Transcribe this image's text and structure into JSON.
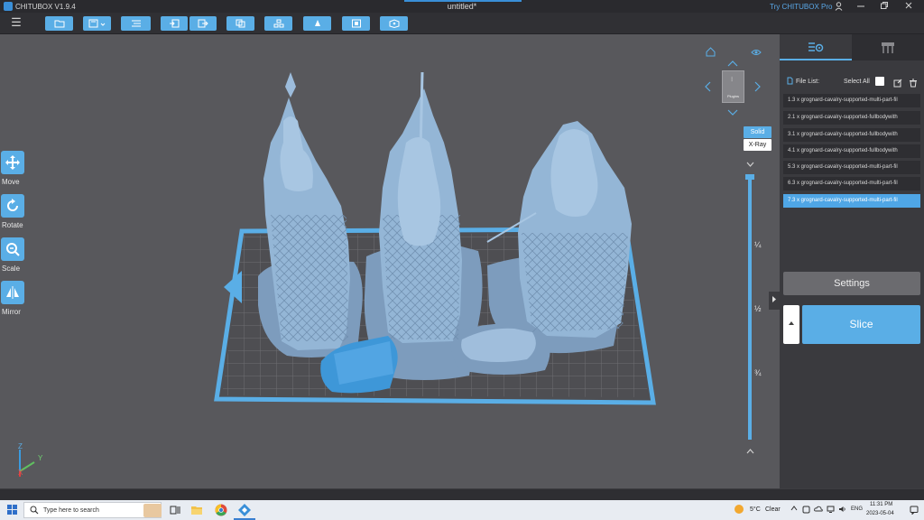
{
  "app": {
    "name": "CHITUBOX V1.9.4",
    "document_title": "untitled*",
    "pro_link": "Try CHITUBOX Pro"
  },
  "window_controls": [
    "minimize",
    "restore",
    "close"
  ],
  "toolbar": {
    "menu_icon": "hamburger-icon",
    "buttons": [
      "open-file-icon",
      "save-dropdown-icon",
      "slice-settings-icon",
      "import-icon",
      "export-icon",
      "copy-icon",
      "layout-icon",
      "support-icon",
      "hollow-icon",
      "dig-hole-icon"
    ]
  },
  "left_tools": [
    {
      "label": "Move",
      "icon": "move-icon"
    },
    {
      "label": "Rotate",
      "icon": "rotate-icon"
    },
    {
      "label": "Scale",
      "icon": "scale-icon"
    },
    {
      "label": "Mirror",
      "icon": "mirror-icon"
    }
  ],
  "view": {
    "navcube_face": "Plugins",
    "modes": [
      "Solid",
      "X-Ray"
    ],
    "active_mode": "Solid",
    "layer_marks": [
      "¼",
      "½",
      "¾"
    ],
    "axes": [
      "Z",
      "Y",
      "X"
    ]
  },
  "colors": {
    "accent": "#5aaee6",
    "model": "#8fb4d4",
    "selected_model": "#3e97d8",
    "viewport_bg": "#58585c",
    "panel_bg": "#3a3a3e"
  },
  "panel": {
    "file_list_label": "File List:",
    "select_all_label": "Select All",
    "select_all_checked": false,
    "files": [
      "1.3 x grognard-cavalry-supported-multi-part-fil",
      "2.1 x grognard-cavalry-supported-fullbodywith",
      "3.1 x grognard-cavalry-supported-fullbodywith",
      "4.1 x grognard-cavalry-supported-fullbodywith",
      "5.3 x grognard-cavalry-supported-multi-part-fil",
      "6.3 x grognard-cavalry-supported-multi-part-fil",
      "7.3 x grognard-cavalry-supported-multi-part-fil"
    ],
    "selected_file_index": 6,
    "settings_label": "Settings",
    "slice_label": "Slice"
  },
  "taskbar": {
    "search_placeholder": "Type here to search",
    "apps": [
      "task-view-icon",
      "file-explorer-icon",
      "chrome-icon",
      "chitubox-icon"
    ],
    "weather_temp": "5°C",
    "weather_cond": "Clear",
    "lang": "ENG",
    "time": "11:31 PM",
    "date": "2023-05-04"
  }
}
